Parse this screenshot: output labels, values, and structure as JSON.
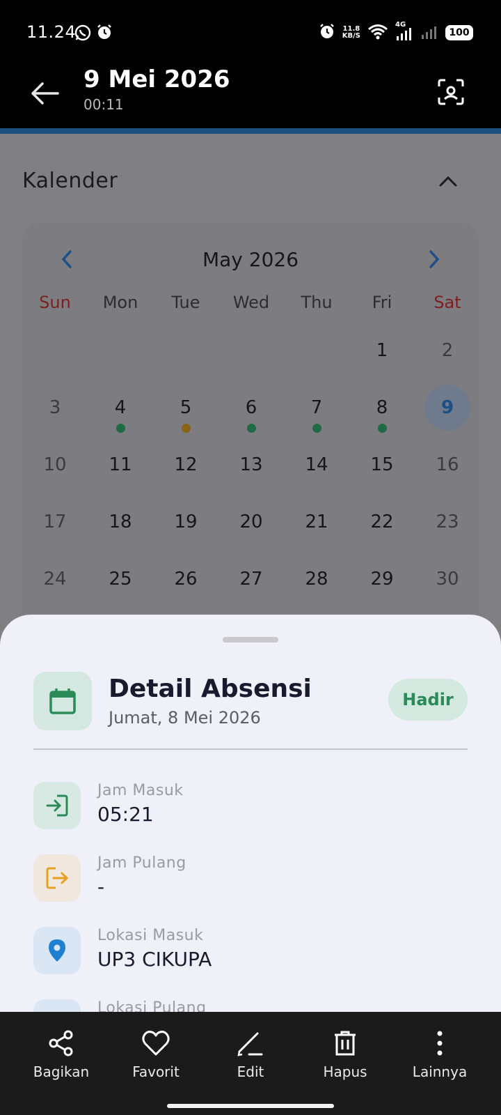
{
  "status_bar": {
    "time": "11.24",
    "net_speed_value": "11.8",
    "net_speed_unit": "KB/S",
    "network_type": "4G",
    "battery": "100",
    "icons": [
      "whatsapp-icon",
      "alarm-icon",
      "alarm-icon",
      "wifi-icon",
      "signal-icon",
      "signal-icon",
      "battery-icon"
    ]
  },
  "app_bar": {
    "title": "9 Mei 2026",
    "subtitle": "00:11",
    "back_icon": "arrow-left-icon",
    "action_icon": "scan-icon"
  },
  "calendar_section": {
    "title": "Kalender",
    "collapse_icon": "chevron-up-icon",
    "month_label": "May 2026",
    "weekdays": [
      "Sun",
      "Mon",
      "Tue",
      "Wed",
      "Thu",
      "Fri",
      "Sat"
    ],
    "selected_day": "9",
    "weeks": [
      [
        "",
        "",
        "",
        "",
        "",
        "1",
        "2"
      ],
      [
        "3",
        "4",
        "5",
        "6",
        "7",
        "8",
        "9"
      ],
      [
        "10",
        "11",
        "12",
        "13",
        "14",
        "15",
        "16"
      ],
      [
        "17",
        "18",
        "19",
        "20",
        "21",
        "22",
        "23"
      ],
      [
        "24",
        "25",
        "26",
        "27",
        "28",
        "29",
        "30"
      ]
    ],
    "attendance_markers": [
      {
        "day": "4",
        "color": "#1e6b45"
      },
      {
        "day": "5",
        "color": "#8a6414"
      },
      {
        "day": "6",
        "color": "#1e6b45"
      },
      {
        "day": "7",
        "color": "#1e6b45"
      },
      {
        "day": "8",
        "color": "#1e6b45"
      }
    ]
  },
  "detail_sheet": {
    "title": "Detail Absensi",
    "date": "Jumat, 8 Mei 2026",
    "status": "Hadir",
    "status_color": "#2a8a58",
    "rows": [
      {
        "label": "Jam Masuk",
        "value": "05:21",
        "icon": "login-icon",
        "icon_color": "#2a8a58"
      },
      {
        "label": "Jam Pulang",
        "value": "-",
        "icon": "logout-icon",
        "icon_color": "#e8a021"
      },
      {
        "label": "Lokasi Masuk",
        "value": "UP3 CIKUPA",
        "icon": "location-pin-icon",
        "icon_color": "#1f7fd1"
      },
      {
        "label": "Lokasi Pulang",
        "value": "",
        "icon": "location-pin-icon",
        "icon_color": "#1f7fd1"
      }
    ]
  },
  "action_bar": {
    "items": [
      {
        "label": "Bagikan",
        "icon": "share-icon"
      },
      {
        "label": "Favorit",
        "icon": "heart-icon"
      },
      {
        "label": "Edit",
        "icon": "edit-icon"
      },
      {
        "label": "Hapus",
        "icon": "trash-icon"
      },
      {
        "label": "Lainnya",
        "icon": "more-vertical-icon"
      }
    ]
  }
}
